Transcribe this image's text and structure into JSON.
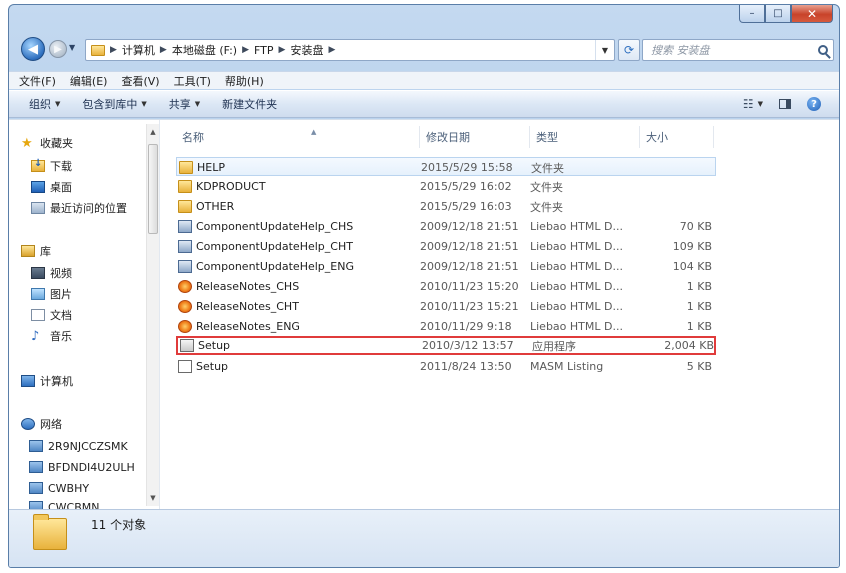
{
  "window": {
    "caption_buttons": {
      "minimize": "–",
      "maximize": "□",
      "close": "✕"
    }
  },
  "address": {
    "crumbs": [
      "计算机",
      "本地磁盘 (F:)",
      "FTP",
      "安装盘"
    ],
    "search_placeholder": "搜索 安装盘"
  },
  "menu": [
    "文件(F)",
    "编辑(E)",
    "查看(V)",
    "工具(T)",
    "帮助(H)"
  ],
  "toolbar": {
    "organize": "组织",
    "include_in_library": "包含到库中",
    "share": "共享",
    "new_folder": "新建文件夹"
  },
  "nav_pane": {
    "favorites": "收藏夹",
    "downloads": "下载",
    "desktop": "桌面",
    "recent": "最近访问的位置",
    "libraries": "库",
    "videos": "视频",
    "pictures": "图片",
    "documents": "文档",
    "music": "音乐",
    "computer": "计算机",
    "network": "网络",
    "network_items": [
      "2R9NJCCZSMK",
      "BFDNDI4U2ULH",
      "CWBHY",
      "CWCBMN"
    ]
  },
  "columns": {
    "name": "名称",
    "date": "修改日期",
    "type": "类型",
    "size": "大小"
  },
  "files": [
    {
      "name": "HELP",
      "date": "2015/5/29 15:58",
      "type": "文件夹",
      "size": "",
      "icon": "folder-icon"
    },
    {
      "name": "KDPRODUCT",
      "date": "2015/5/29 16:02",
      "type": "文件夹",
      "size": "",
      "icon": "folder-icon"
    },
    {
      "name": "OTHER",
      "date": "2015/5/29 16:03",
      "type": "文件夹",
      "size": "",
      "icon": "folder-icon"
    },
    {
      "name": "ComponentUpdateHelp_CHS",
      "date": "2009/12/18 21:51",
      "type": "Liebao HTML D...",
      "size": "70 KB",
      "icon": "chm-icon"
    },
    {
      "name": "ComponentUpdateHelp_CHT",
      "date": "2009/12/18 21:51",
      "type": "Liebao HTML D...",
      "size": "109 KB",
      "icon": "chm-icon"
    },
    {
      "name": "ComponentUpdateHelp_ENG",
      "date": "2009/12/18 21:51",
      "type": "Liebao HTML D...",
      "size": "104 KB",
      "icon": "chm-icon"
    },
    {
      "name": "ReleaseNotes_CHS",
      "date": "2010/11/23 15:20",
      "type": "Liebao HTML D...",
      "size": "1 KB",
      "icon": "html-icon"
    },
    {
      "name": "ReleaseNotes_CHT",
      "date": "2010/11/23 15:21",
      "type": "Liebao HTML D...",
      "size": "1 KB",
      "icon": "html-icon"
    },
    {
      "name": "ReleaseNotes_ENG",
      "date": "2010/11/29 9:18",
      "type": "Liebao HTML D...",
      "size": "1 KB",
      "icon": "html-icon"
    },
    {
      "name": "Setup",
      "date": "2010/3/12 13:57",
      "type": "应用程序",
      "size": "2,004 KB",
      "icon": "exe-icon"
    },
    {
      "name": "Setup",
      "date": "2011/8/24 13:50",
      "type": "MASM Listing",
      "size": "5 KB",
      "icon": "document-icon"
    }
  ],
  "details": {
    "count_text": "11 个对象"
  },
  "colors": {
    "highlight_outline": "#e03b3b",
    "frame": "#a9c7e8"
  }
}
